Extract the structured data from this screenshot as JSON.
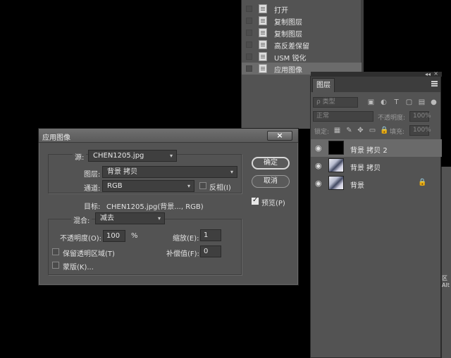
{
  "history": {
    "items": [
      {
        "label": "打开"
      },
      {
        "label": "复制图层"
      },
      {
        "label": "复制图层"
      },
      {
        "label": "高反差保留"
      },
      {
        "label": "USM 锐化"
      },
      {
        "label": "应用图像"
      }
    ]
  },
  "layers_panel": {
    "tab_label": "图层",
    "filter_placeholder": "ρ 类型",
    "blend_mode": "正常",
    "opacity_label": "不透明度:",
    "opacity_value": "100%",
    "lock_label": "锁定:",
    "fill_label": "填充:",
    "fill_value": "100%",
    "layers": [
      {
        "name": "背景 拷贝 2",
        "active": true
      },
      {
        "name": "背景 拷贝",
        "active": false
      },
      {
        "name": "背景",
        "active": false
      }
    ]
  },
  "right_panel": {
    "text1": "区",
    "text2": "Alt"
  },
  "dialog": {
    "title": "应用图像",
    "source_label": "源:",
    "source_value": "CHEN1205.jpg",
    "layer_label": "图层:",
    "layer_value": "背景 拷贝",
    "channel_label": "通道:",
    "channel_value": "RGB",
    "invert_label": "反相(I)",
    "target_label": "目标:",
    "target_value": "CHEN1205.jpg(背景..., RGB)",
    "blending_label": "混合:",
    "blending_value": "减去",
    "opacity_label": "不透明度(O):",
    "opacity_value": "100",
    "opacity_unit": "%",
    "scale_label": "缩放(E):",
    "scale_value": "1",
    "offset_label": "补偿值(F):",
    "offset_value": "0",
    "preserve_label": "保留透明区域(T)",
    "mask_label": "蒙版(K)...",
    "ok_label": "确定",
    "cancel_label": "取消",
    "preview_label": "预览(P)",
    "preview_checked": true,
    "close_glyph": "×"
  }
}
